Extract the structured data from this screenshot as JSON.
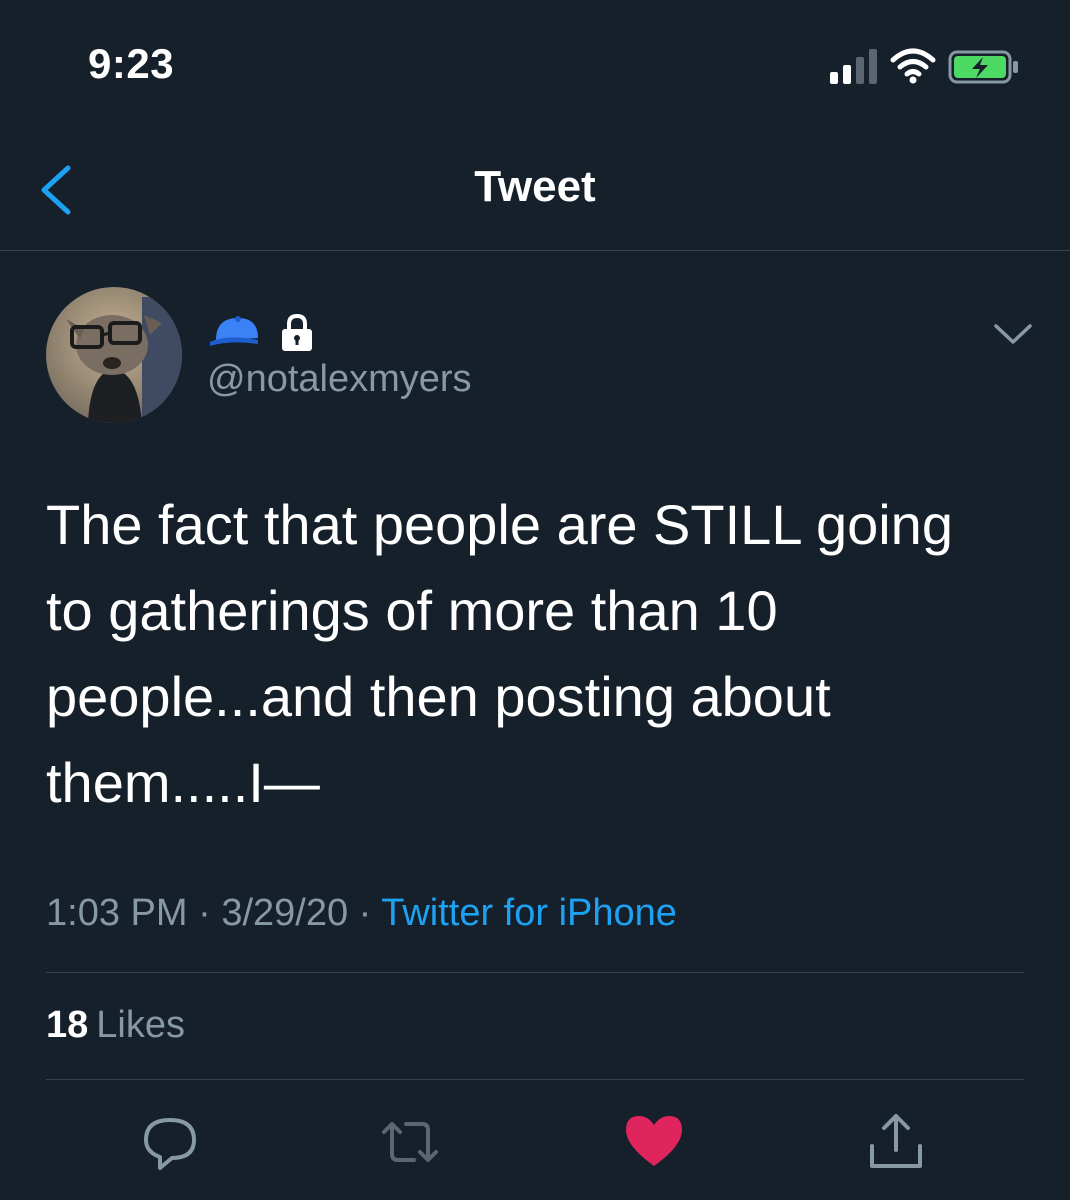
{
  "status_bar": {
    "time": "9:23",
    "icons": [
      "signal-icon",
      "wifi-icon",
      "battery-charging-icon"
    ]
  },
  "nav": {
    "back_icon": "chevron-left-icon",
    "title": "Tweet"
  },
  "tweet": {
    "author": {
      "avatar": "avatar-dog-with-glasses",
      "name_icons": [
        "cap-icon",
        "lock-icon"
      ],
      "handle": "@notalexmyers"
    },
    "text_lines": [
      "The fact that people are STILL going",
      "to gatherings of more than 10",
      "people...and then posting about",
      "them.....I—"
    ],
    "time": "1:03 PM",
    "separator": "·",
    "date": "3/29/20",
    "source": "Twitter for iPhone",
    "likes_count": "18",
    "likes_label": "Likes"
  },
  "actions": [
    "reply-icon",
    "retweet-icon",
    "like-icon",
    "share-icon"
  ],
  "colors": {
    "background": "#15202b",
    "divider": "#38444d",
    "secondary_text": "#8899a6",
    "accent": "#1da1f2",
    "like": "#e0245e",
    "battery": "#4cd964"
  }
}
